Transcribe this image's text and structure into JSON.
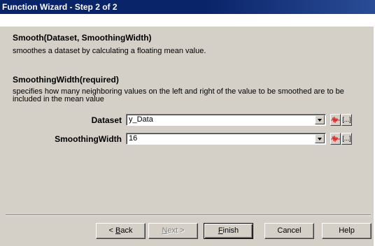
{
  "window": {
    "title": "Function Wizard - Step 2 of 2"
  },
  "function": {
    "signature": "Smooth(Dataset, SmoothingWidth)",
    "description": "smoothes a dataset by calculating a floating mean value."
  },
  "parameter": {
    "title": "SmoothingWidth(required)",
    "description": "specifies how many neighboring values on the left and right of the value to be smoothed are to be included in the mean value"
  },
  "fields": [
    {
      "label": "Dataset",
      "value": "y_Data",
      "wave_icon": "waveform-icon",
      "browse_label": "[...]"
    },
    {
      "label": "SmoothingWidth",
      "value": "16",
      "wave_icon": "waveform-icon",
      "browse_label": "[...]"
    }
  ],
  "buttons": {
    "back": {
      "mnemonic": "B",
      "rest": "ack",
      "prefix": "< "
    },
    "next": {
      "mnemonic": "N",
      "rest": "ext",
      "suffix": " >"
    },
    "finish": {
      "mnemonic": "F",
      "rest": "inish"
    },
    "cancel": {
      "label": "Cancel"
    },
    "help": {
      "label": "Help"
    }
  },
  "colors": {
    "titlebar": "#0a246a",
    "face": "#d4d0c8",
    "wave_icon": "#e02020"
  }
}
